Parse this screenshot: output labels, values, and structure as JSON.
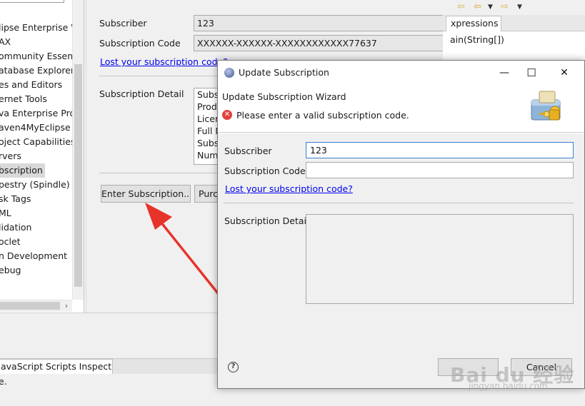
{
  "preferences": {
    "tree_items": [
      "lipse Enterprise W",
      "AX",
      "ommunity Essentia",
      "atabase Explorer",
      "es and Editors",
      "ernet Tools",
      "va Enterprise Proj",
      "aven4MyEclipse",
      "oject Capabilities",
      "rvers",
      "bscription",
      "pestry (Spindle)",
      "sk Tags",
      "ML",
      "lidation",
      "oclet",
      "n Development",
      "ebug"
    ],
    "selected_tree_item": "bscription",
    "subscriber_label": "Subscriber",
    "subscriber_value": "123",
    "code_label": "Subscription Code",
    "code_value": "XXXXXX-XXXXXX-XXXXXXXXXXXX77637",
    "lost_code_link": "Lost your subscription code?",
    "detail_label": "Subscription Detail",
    "detail_lines": [
      "Subs",
      "Prod",
      "Licer",
      "Full N",
      "Subs",
      "Num"
    ],
    "enter_button": "Enter Subscription...",
    "purchase_button": "Purc"
  },
  "right_views": {
    "expressions_tab": "xpressions",
    "expression_line": "ain(String[])"
  },
  "bottom": {
    "js_tab": "avaScript Scripts Inspector",
    "status_text": "e."
  },
  "dialog": {
    "title": "Update Subscription",
    "wizard_title": "Update Subscription Wizard",
    "error_message": "Please enter a valid subscription code.",
    "subscriber_label": "Subscriber",
    "subscriber_value": "123",
    "code_label": "Subscription Code",
    "code_value": "",
    "lost_code_link": "Lost your subscription code?",
    "detail_label": "Subscription Detail",
    "cancel_button": "Cancel",
    "controls": {
      "minimize": "—",
      "maximize": "☐",
      "close": "✕"
    },
    "help_glyph": "?"
  },
  "watermark": {
    "text": "Bai du 经验",
    "sub": "jingyan.baidu.com"
  },
  "colors": {
    "link": "#0000ee",
    "error": "#e0443e",
    "focus": "#3c7fd1",
    "arrow": "#e8332b"
  }
}
